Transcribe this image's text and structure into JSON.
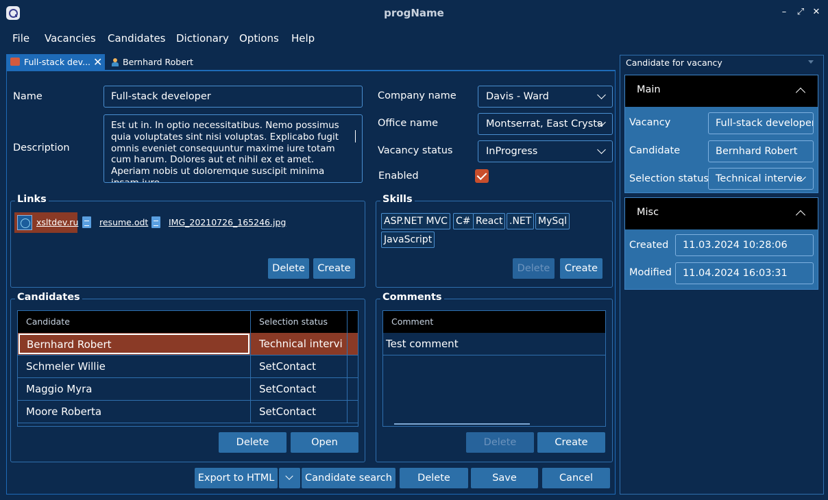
{
  "window": {
    "title": "progName",
    "controls": [
      "–",
      "⤢",
      "✕"
    ]
  },
  "menu": [
    "File",
    "Vacancies",
    "Candidates",
    "Dictionary",
    "Options",
    "Help"
  ],
  "tabs": [
    {
      "label": "Full-stack dev...",
      "icon": "vacancy-icon",
      "active": true
    },
    {
      "label": "Bernhard Robert",
      "icon": "person-icon",
      "active": false
    }
  ],
  "form": {
    "name_label": "Name",
    "name_value": "Full-stack developer",
    "description_label": "Description",
    "description_value": "Est ut in. In optio necessitatibus. Nemo possimus quia voluptates sint nisi voluptas. Explicabo fugit omnis eveniet consequuntur maxime iure totam cum harum. Dolores aut et nihil ex et amet. Aperiam nobis ut doloremque suscipit minima ipsam iure.",
    "company_label": "Company name",
    "company_value": "Davis - Ward",
    "office_label": "Office name",
    "office_value": "Montserrat, East Crysta",
    "status_label": "Vacancy status",
    "status_value": "InProgress",
    "enabled_label": "Enabled",
    "enabled_checked": true
  },
  "links": {
    "title": "Links",
    "items": [
      "xsltdev.ru",
      "resume.odt",
      "IMG_20210726_165246.jpg"
    ],
    "delete_label": "Delete",
    "create_label": "Create"
  },
  "skills": {
    "title": "Skills",
    "items": [
      "ASP.NET MVC",
      "C#",
      "React",
      ".NET",
      "MySql",
      "JavaScript"
    ],
    "delete_label": "Delete",
    "create_label": "Create"
  },
  "candidates": {
    "title": "Candidates",
    "columns": [
      "Candidate",
      "Selection status"
    ],
    "rows": [
      {
        "name": "Bernhard Robert",
        "status": "Technical intervi",
        "selected": true
      },
      {
        "name": "Schmeler Willie",
        "status": "SetContact"
      },
      {
        "name": "Maggio Myra",
        "status": "SetContact"
      },
      {
        "name": "Moore Roberta",
        "status": "SetContact"
      }
    ],
    "delete_label": "Delete",
    "open_label": "Open"
  },
  "comments": {
    "title": "Comments",
    "column": "Comment",
    "rows": [
      "Test comment"
    ],
    "delete_label": "Delete",
    "create_label": "Create"
  },
  "footer": {
    "export_label": "Export to HTML",
    "search_label": "Candidate search",
    "delete_label": "Delete",
    "save_label": "Save",
    "cancel_label": "Cancel"
  },
  "right_panel": {
    "title": "Candidate for vacancy",
    "main": {
      "header": "Main",
      "vacancy_label": "Vacancy",
      "vacancy_value": "Full-stack developer",
      "candidate_label": "Candidate",
      "candidate_value": "Bernhard Robert",
      "selection_label": "Selection status",
      "selection_value": "Technical intervie"
    },
    "misc": {
      "header": "Misc",
      "created_label": "Created",
      "created_value": "11.03.2024 10:28:06",
      "modified_label": "Modified",
      "modified_value": "11.04.2024 16:03:31"
    }
  },
  "colors": {
    "background": "#0c2a4e",
    "accent": "#1e6bb8",
    "button": "#2c6fa8",
    "selection": "#8a3a26",
    "checkbox": "#c84e2c"
  }
}
